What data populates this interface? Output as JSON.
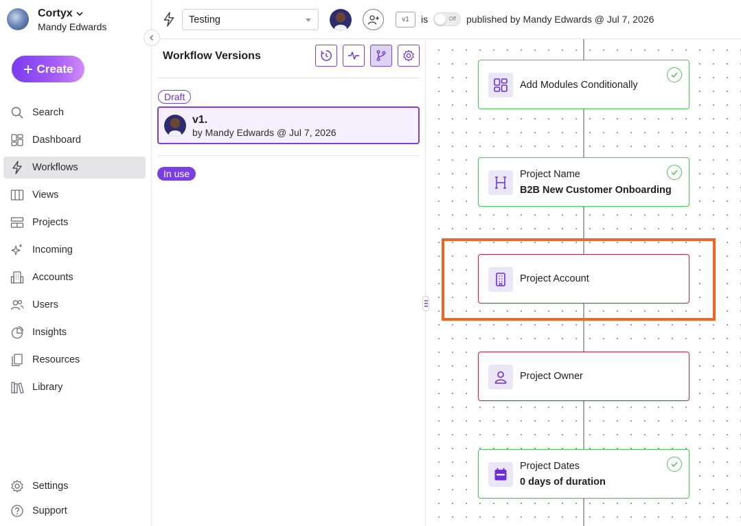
{
  "sidebar": {
    "brand": {
      "name": "Cortyx",
      "user": "Mandy Edwards"
    },
    "create_label": "Create",
    "items": [
      {
        "label": "Search",
        "icon": "search-icon"
      },
      {
        "label": "Dashboard",
        "icon": "dashboard-icon"
      },
      {
        "label": "Workflows",
        "icon": "bolt-icon",
        "active": true
      },
      {
        "label": "Views",
        "icon": "columns-icon"
      },
      {
        "label": "Projects",
        "icon": "projects-icon"
      },
      {
        "label": "Incoming",
        "icon": "sparkle-icon"
      },
      {
        "label": "Accounts",
        "icon": "building-icon"
      },
      {
        "label": "Users",
        "icon": "users-icon"
      },
      {
        "label": "Insights",
        "icon": "pie-chart-icon"
      },
      {
        "label": "Resources",
        "icon": "documents-icon"
      },
      {
        "label": "Library",
        "icon": "books-icon"
      }
    ],
    "bottom_items": [
      {
        "label": "Settings",
        "icon": "gear-icon"
      },
      {
        "label": "Support",
        "icon": "help-circle-icon"
      }
    ]
  },
  "topbar": {
    "workflow_select": "Testing",
    "version_badge": "v1",
    "is_text": "is",
    "toggle_label": "Off",
    "published_text": "published by Mandy Edwards @ Jul 7, 2026"
  },
  "versions_panel": {
    "title": "Workflow Versions",
    "draft_label": "Draft",
    "card": {
      "title": "v1.",
      "subtitle": "by Mandy Edwards @ Jul 7, 2026"
    },
    "in_use_label": "In use"
  },
  "canvas": {
    "nodes": [
      {
        "label": "Add Modules Conditionally",
        "value": "",
        "status": "complete",
        "icon": "grid-modules-icon"
      },
      {
        "label": "Project Name",
        "value": "B2B New Customer Onboarding",
        "status": "complete",
        "icon": "heading-h-icon"
      },
      {
        "label": "Project Account",
        "value": "",
        "status": "error",
        "icon": "building-icon"
      },
      {
        "label": "Project Owner",
        "value": "",
        "status": "error",
        "icon": "person-icon"
      },
      {
        "label": "Project Dates",
        "value": "0 days of duration",
        "status": "complete",
        "icon": "calendar-icon"
      }
    ]
  },
  "colors": {
    "accent": "#7a3fe0",
    "success": "#52c25a",
    "error": "#d0243a",
    "highlight": "#f26522"
  }
}
